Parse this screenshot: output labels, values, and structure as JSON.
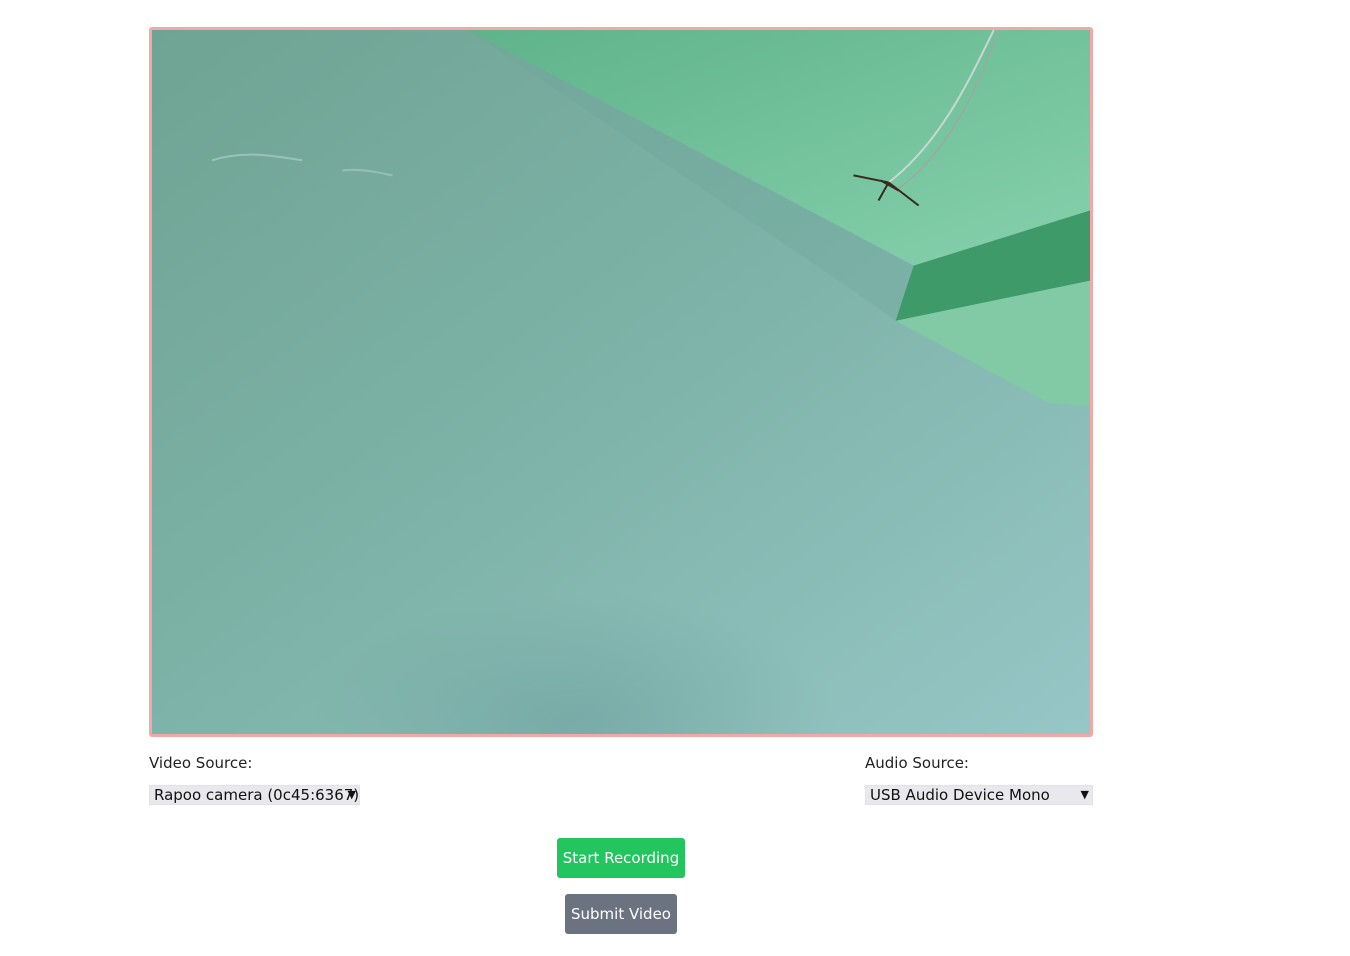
{
  "video": {
    "border_color": "#f3a8a8"
  },
  "video_source": {
    "label": "Video Source:",
    "selected": "Rapoo camera (0c45:6367)"
  },
  "audio_source": {
    "label": "Audio Source:",
    "selected": "USB Audio Device Mono"
  },
  "buttons": {
    "start_recording": "Start Recording",
    "submit_video": "Submit Video"
  },
  "colors": {
    "start_recording_bg": "#22c55e",
    "submit_video_bg": "#6b7280"
  }
}
